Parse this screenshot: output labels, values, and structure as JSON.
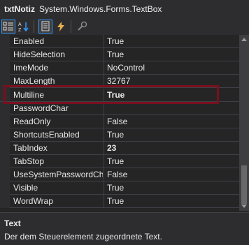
{
  "header": {
    "object_name": "txtNotiz",
    "object_type": "System.Windows.Forms.TextBox"
  },
  "toolbar": {
    "buttons": [
      {
        "icon": "categorized-icon",
        "active": true
      },
      {
        "icon": "alphabetical-icon",
        "active": false
      },
      {
        "icon": "properties-icon",
        "active": true
      },
      {
        "icon": "events-icon",
        "active": false
      },
      {
        "icon": "property-pages-icon",
        "active": false
      }
    ]
  },
  "properties": [
    {
      "name": "Enabled",
      "value": "True",
      "bold": false
    },
    {
      "name": "HideSelection",
      "value": "True",
      "bold": false
    },
    {
      "name": "ImeMode",
      "value": "NoControl",
      "bold": false
    },
    {
      "name": "MaxLength",
      "value": "32767",
      "bold": false
    },
    {
      "name": "Multiline",
      "value": "True",
      "bold": true
    },
    {
      "name": "PasswordChar",
      "value": "",
      "bold": false
    },
    {
      "name": "ReadOnly",
      "value": "False",
      "bold": false
    },
    {
      "name": "ShortcutsEnabled",
      "value": "True",
      "bold": false
    },
    {
      "name": "TabIndex",
      "value": "23",
      "bold": true
    },
    {
      "name": "TabStop",
      "value": "True",
      "bold": false
    },
    {
      "name": "UseSystemPasswordCha",
      "value": "False",
      "bold": false
    },
    {
      "name": "Visible",
      "value": "True",
      "bold": false
    },
    {
      "name": "WordWrap",
      "value": "True",
      "bold": false
    }
  ],
  "description": {
    "title": "Text",
    "text": "Der dem Steuerelement zugeordnete Text."
  },
  "colors": {
    "highlight_border": "#7a0f1e",
    "active_button_border": "#3399ff"
  }
}
